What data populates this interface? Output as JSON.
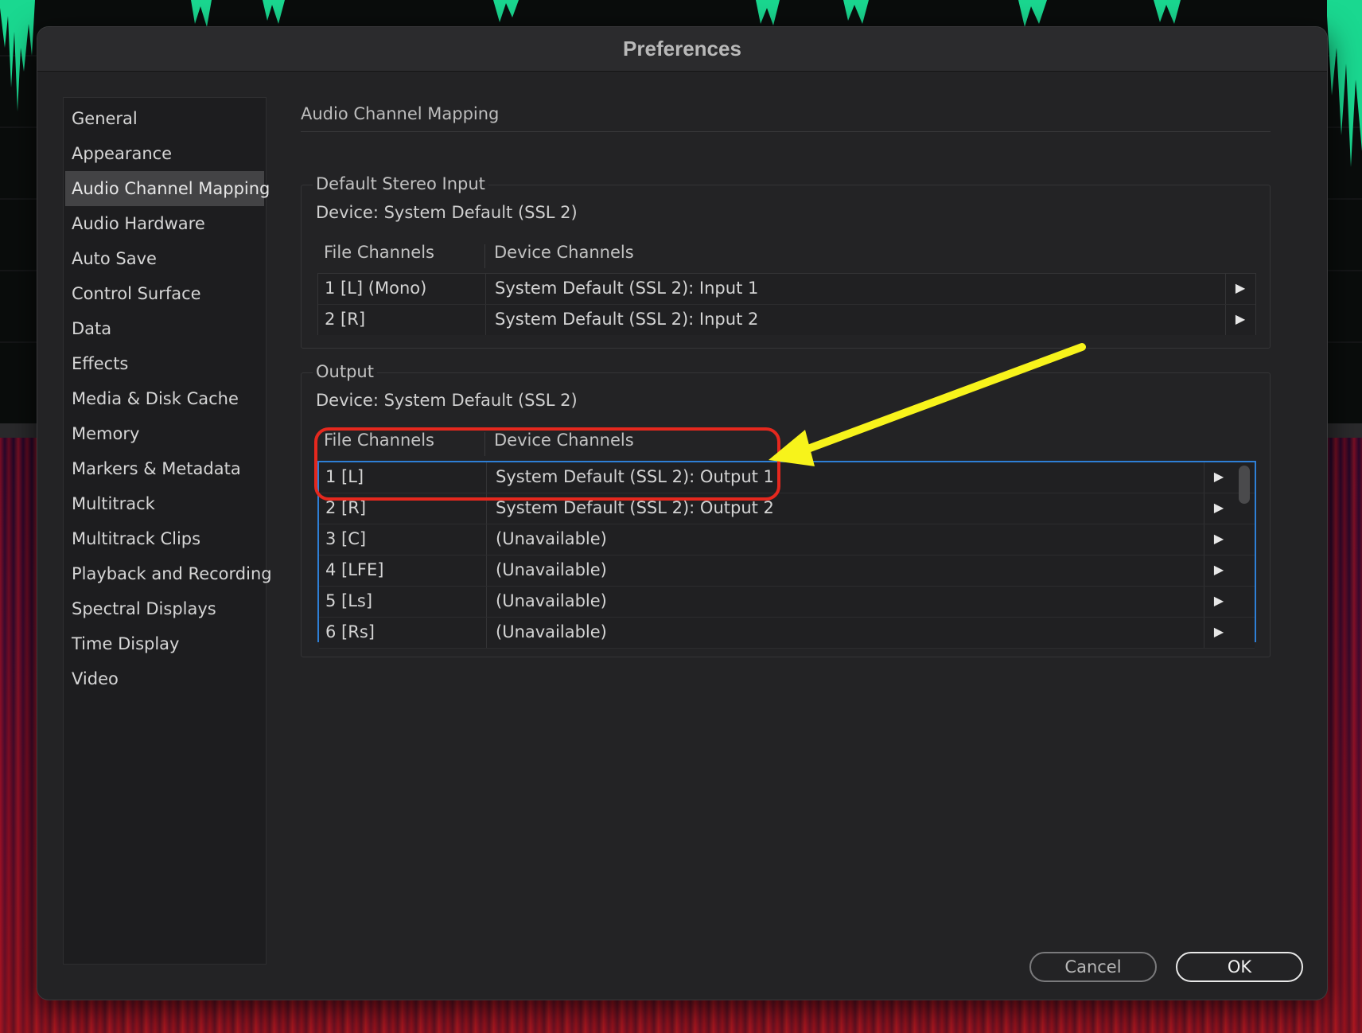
{
  "dialog": {
    "title": "Preferences"
  },
  "sidebar": {
    "selected_index": 2,
    "items": [
      {
        "label": "General"
      },
      {
        "label": "Appearance"
      },
      {
        "label": "Audio Channel Mapping"
      },
      {
        "label": "Audio Hardware"
      },
      {
        "label": "Auto Save"
      },
      {
        "label": "Control Surface"
      },
      {
        "label": "Data"
      },
      {
        "label": "Effects"
      },
      {
        "label": "Media & Disk Cache"
      },
      {
        "label": "Memory"
      },
      {
        "label": "Markers & Metadata"
      },
      {
        "label": "Multitrack"
      },
      {
        "label": "Multitrack Clips"
      },
      {
        "label": "Playback and Recording"
      },
      {
        "label": "Spectral Displays"
      },
      {
        "label": "Time Display"
      },
      {
        "label": "Video"
      }
    ]
  },
  "main": {
    "section_title": "Audio Channel Mapping",
    "input": {
      "legend": "Default Stereo Input",
      "device": "Device: System Default (SSL 2)",
      "col_file": "File Channels",
      "col_device": "Device Channels",
      "rows": [
        {
          "file": "1 [L] (Mono)",
          "device": "System Default (SSL 2):  Input 1"
        },
        {
          "file": "2 [R]",
          "device": "System Default (SSL 2):  Input 2"
        }
      ]
    },
    "output": {
      "legend": "Output",
      "device": "Device: System Default (SSL 2)",
      "col_file": "File Channels",
      "col_device": "Device Channels",
      "rows": [
        {
          "file": "1 [L]",
          "device": "System Default (SSL 2):  Output 1"
        },
        {
          "file": "2 [R]",
          "device": "System Default (SSL 2):  Output 2"
        },
        {
          "file": "3 [C]",
          "device": "(Unavailable)"
        },
        {
          "file": "4 [LFE]",
          "device": "(Unavailable)"
        },
        {
          "file": "5 [Ls]",
          "device": "(Unavailable)"
        },
        {
          "file": "6 [Rs]",
          "device": "(Unavailable)"
        }
      ]
    }
  },
  "footer": {
    "cancel_label": "Cancel",
    "ok_label": "OK"
  },
  "icons": {
    "expand": "play-triangle-icon"
  },
  "colors": {
    "accent_focus": "#2e7fd6",
    "annotation_box": "#e5281e",
    "annotation_arrow": "#f7f31b",
    "waveform": "#1ad890"
  }
}
